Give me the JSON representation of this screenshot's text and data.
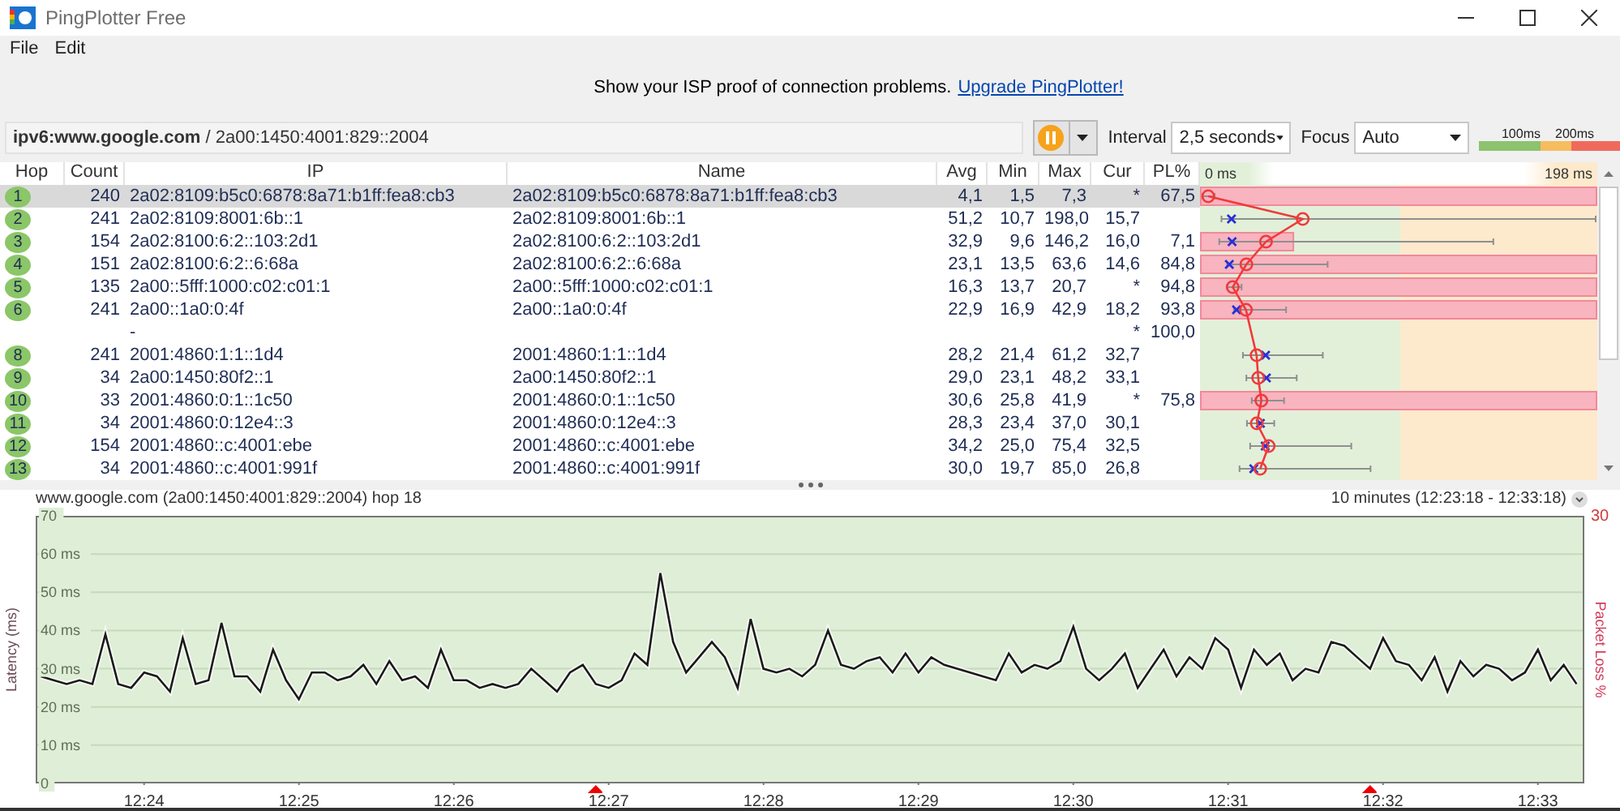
{
  "window": {
    "title": "PingPlotter Free"
  },
  "menu": [
    "File",
    "Edit"
  ],
  "banner": {
    "text": "Show your ISP proof of connection problems.",
    "link": "Upgrade PingPlotter!"
  },
  "toolbar": {
    "target": "**ipv6:www.google.com** / 2a00:1450:4001:829::2004",
    "interval_label": "Interval",
    "interval": "2,5 seconds",
    "focus_label": "Focus",
    "focus": "Auto",
    "legend": [
      "100ms",
      "200ms"
    ]
  },
  "table": {
    "columns": [
      "Hop",
      "Count",
      "IP",
      "Name",
      "Avg",
      "Min",
      "Max",
      "Cur",
      "PL%"
    ],
    "graph_scale": [
      "0 ms",
      "198 ms"
    ],
    "rows": [
      {
        "hop": "1",
        "count": "240",
        "ip": "2a02:8109:b5c0:6878:8a71:b1ff:fea8:cb3",
        "name": "2a02:8109:b5c0:6878:8a71:b1ff:fea8:cb3",
        "avg": "4,1",
        "min": "1,5",
        "max": "7,3",
        "cur": "*",
        "pl": "67,5",
        "level": 1,
        "selected": true
      },
      {
        "hop": "2",
        "count": "241",
        "ip": "2a02:8109:8001:6b::1",
        "name": "2a02:8109:8001:6b::1",
        "avg": "51,2",
        "min": "10,7",
        "max": "198,0",
        "cur": "15,7",
        "selected": false
      },
      {
        "hop": "3",
        "count": "154",
        "ip": "2a02:8100:6:2::103:2d1",
        "name": "2a02:8100:6:2::103:2d1",
        "avg": "32,9",
        "min": "9,6",
        "max": "146,2",
        "cur": "16,0",
        "pl": "7,1",
        "level": 0.237,
        "selected": false
      },
      {
        "hop": "4",
        "count": "151",
        "ip": "2a02:8100:6:2::6:68a",
        "name": "2a02:8100:6:2::6:68a",
        "avg": "23,1",
        "min": "13,5",
        "max": "63,6",
        "cur": "14,6",
        "pl": "84,8",
        "level": 1,
        "selected": false
      },
      {
        "hop": "5",
        "count": "135",
        "ip": "2a00::5fff:1000:c02:c01:1",
        "name": "2a00::5fff:1000:c02:c01:1",
        "avg": "16,3",
        "min": "13,7",
        "max": "20,7",
        "cur": "*",
        "pl": "94,8",
        "level": 1,
        "selected": false
      },
      {
        "hop": "6",
        "count": "241",
        "ip": "2a00::1a0:0:4f",
        "name": "2a00::1a0:0:4f",
        "avg": "22,9",
        "min": "16,9",
        "max": "42,9",
        "cur": "18,2",
        "pl": "93,8",
        "level": 1,
        "selected": false
      },
      {
        "ip": "-",
        "cur": "*",
        "pl": "100,0",
        "selected": false
      },
      {
        "hop": "8",
        "count": "241",
        "ip": "2001:4860:1:1::1d4",
        "name": "2001:4860:1:1::1d4",
        "avg": "28,2",
        "min": "21,4",
        "max": "61,2",
        "cur": "32,7",
        "selected": false
      },
      {
        "hop": "9",
        "count": "34",
        "ip": "2a00:1450:80f2::1",
        "name": "2a00:1450:80f2::1",
        "avg": "29,0",
        "min": "23,1",
        "max": "48,2",
        "cur": "33,1",
        "selected": false
      },
      {
        "hop": "10",
        "count": "33",
        "ip": "2001:4860:0:1::1c50",
        "name": "2001:4860:0:1::1c50",
        "avg": "30,6",
        "min": "25,8",
        "max": "41,9",
        "cur": "*",
        "pl": "75,8",
        "level": 1,
        "selected": false
      },
      {
        "hop": "11",
        "count": "34",
        "ip": "2001:4860:0:12e4::3",
        "name": "2001:4860:0:12e4::3",
        "avg": "28,3",
        "min": "23,4",
        "max": "37,0",
        "cur": "30,1",
        "selected": false
      },
      {
        "hop": "12",
        "count": "154",
        "ip": "2001:4860::c:4001:ebe",
        "name": "2001:4860::c:4001:ebe",
        "avg": "34,2",
        "min": "25,0",
        "max": "75,4",
        "cur": "32,5",
        "selected": false
      },
      {
        "hop": "13",
        "count": "34",
        "ip": "2001:4860::c:4001:991f",
        "name": "2001:4860::c:4001:991f",
        "avg": "30,0",
        "min": "19,7",
        "max": "85,0",
        "cur": "26,8",
        "selected": false
      }
    ]
  },
  "chart": {
    "title": "www.google.com (2a00:1450:4001:829::2004) hop 18",
    "range": "10 minutes (12:23:18 - 12:33:18)",
    "loss_axis": {
      "label": "Packet Loss %",
      "max": "30"
    },
    "lost_samples": [
      false,
      false,
      false,
      false,
      false,
      false,
      false,
      false,
      false,
      false,
      false,
      false,
      false,
      false,
      false,
      false,
      false,
      false,
      false,
      false,
      false,
      false,
      false,
      false,
      false,
      false,
      false,
      false,
      false,
      false,
      false,
      false,
      false,
      false,
      false,
      false,
      false,
      false,
      false,
      false,
      false,
      false,
      false,
      true,
      false,
      false,
      false,
      false,
      false,
      false,
      false,
      false,
      false,
      false,
      false,
      false,
      false,
      false,
      false,
      false,
      false,
      false,
      false,
      false,
      false,
      false,
      false,
      false,
      false,
      false,
      false,
      false,
      false,
      false,
      false,
      false,
      false,
      false,
      false,
      false,
      false,
      false,
      false,
      false,
      false,
      false,
      false,
      false,
      false,
      false,
      false,
      false,
      false,
      false,
      false,
      false,
      false,
      false,
      false,
      false,
      false,
      false,
      false,
      true,
      false,
      false,
      false,
      false,
      false,
      false,
      false,
      false,
      false,
      false,
      false,
      false,
      false,
      false,
      false,
      false
    ],
    "chart_data": {
      "type": "line",
      "grid": true,
      "ylabel": "Latency (ms)",
      "ylim": [
        0,
        70
      ],
      "categories": [
        null,
        null,
        null,
        null,
        null,
        null,
        null,
        null,
        "12:24",
        null,
        null,
        null,
        null,
        null,
        null,
        null,
        null,
        null,
        null,
        null,
        "12:25",
        null,
        null,
        null,
        null,
        null,
        null,
        null,
        null,
        null,
        null,
        null,
        "12:26",
        null,
        null,
        null,
        null,
        null,
        null,
        null,
        null,
        null,
        null,
        null,
        "12:27",
        null,
        null,
        null,
        null,
        null,
        null,
        null,
        null,
        null,
        null,
        null,
        "12:28",
        null,
        null,
        null,
        null,
        null,
        null,
        null,
        null,
        null,
        null,
        null,
        "12:29",
        null,
        null,
        null,
        null,
        null,
        null,
        null,
        null,
        null,
        null,
        null,
        "12:30",
        null,
        null,
        null,
        null,
        null,
        null,
        null,
        null,
        null,
        null,
        null,
        "12:31",
        null,
        null,
        null,
        null,
        null,
        null,
        null,
        null,
        null,
        null,
        null,
        "12:32",
        null,
        null,
        null,
        null,
        null,
        null,
        null,
        null,
        null,
        null,
        null,
        "12:33",
        null,
        null,
        null
      ],
      "series": [
        {
          "color": "#1a1a1a",
          "values": [
            28,
            27,
            26,
            27,
            26,
            39,
            26,
            25,
            29,
            28,
            24,
            38,
            26,
            27,
            42,
            28,
            28,
            24,
            35,
            27,
            22,
            29,
            29,
            27,
            28,
            31,
            26,
            32,
            27,
            28,
            25,
            35,
            27,
            27,
            25,
            26,
            25,
            26,
            30,
            27,
            24,
            29,
            31,
            26,
            25,
            27,
            34,
            31,
            55,
            37,
            29,
            33,
            37,
            33,
            25,
            43,
            30,
            29,
            30,
            28,
            31,
            40,
            31,
            30,
            32,
            33,
            29,
            34,
            29,
            33,
            31,
            30,
            29,
            28,
            27,
            34,
            29,
            31,
            30,
            32,
            41,
            30,
            27,
            30,
            34,
            25,
            30,
            35,
            28,
            33,
            30,
            38,
            35,
            25,
            35,
            31,
            34,
            27,
            30,
            29,
            37,
            36,
            33,
            30,
            38,
            32,
            31,
            27,
            33,
            24,
            32,
            28,
            31,
            30,
            27,
            29,
            35,
            27,
            31,
            26
          ]
        }
      ],
      "yticks": [
        {
          "value": 0,
          "label": "0"
        },
        {
          "value": 10,
          "label": "10 ms"
        },
        {
          "value": 20,
          "label": "20 ms"
        },
        {
          "value": 30,
          "label": "30 ms"
        },
        {
          "value": 40,
          "label": "40 ms"
        },
        {
          "value": 50,
          "label": "50 ms"
        },
        {
          "value": 60,
          "label": "60 ms"
        },
        {
          "value": 70,
          "label": "70"
        }
      ]
    }
  }
}
